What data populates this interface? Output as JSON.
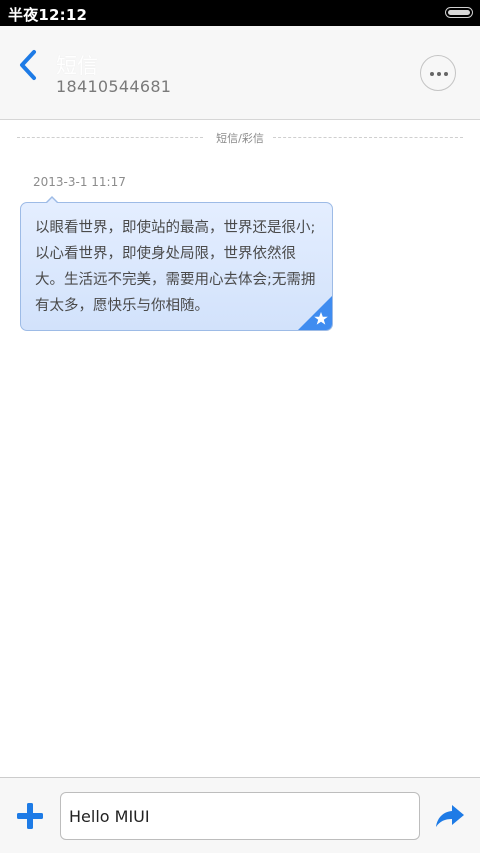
{
  "status_bar": {
    "time": "半夜12:12"
  },
  "header": {
    "title": "短信",
    "subtitle": "18410544681"
  },
  "divider": {
    "label": "短信/彩信"
  },
  "message": {
    "timestamp": "2013-3-1 11:17",
    "text": "以眼看世界，即使站的最高，世界还是很小;以心看世界，即使身处局限，世界依然很大。生活远不完美，需要用心去体会;无需拥有太多，愿快乐与你相随。",
    "starred": true
  },
  "compose": {
    "input_value": "Hello MIUI"
  },
  "colors": {
    "accent": "#1e7be6",
    "bubble": "#dae7fc"
  },
  "icons": {
    "back": "chevron-left-icon",
    "more": "more-dots-icon",
    "add": "plus-icon",
    "send": "send-arrow-icon",
    "star": "star-icon"
  }
}
